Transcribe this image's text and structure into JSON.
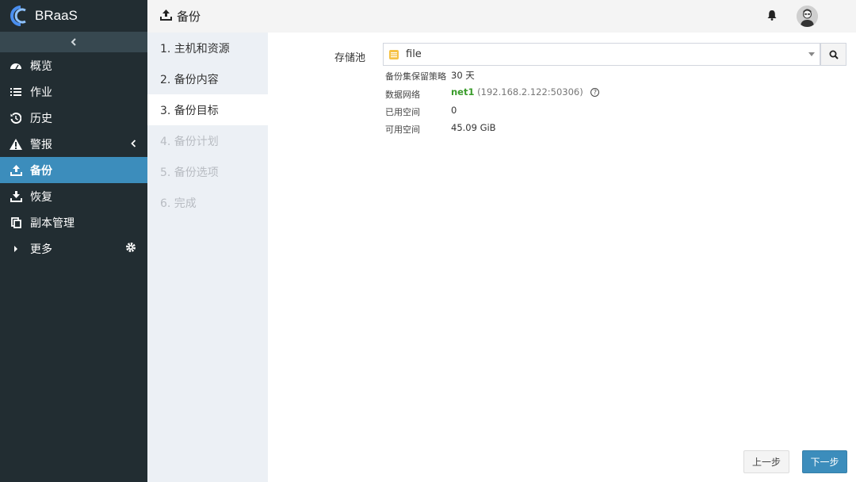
{
  "app": {
    "name": "BRaaS"
  },
  "header": {
    "title": "备份"
  },
  "sidebar": {
    "items": [
      {
        "label": "概览",
        "icon": "dashboard-icon"
      },
      {
        "label": "作业",
        "icon": "tasks-icon"
      },
      {
        "label": "历史",
        "icon": "history-icon"
      },
      {
        "label": "警报",
        "icon": "warning-icon"
      },
      {
        "label": "备份",
        "icon": "upload-icon"
      },
      {
        "label": "恢复",
        "icon": "download-icon"
      },
      {
        "label": "副本管理",
        "icon": "copy-icon"
      },
      {
        "label": "更多",
        "icon": "caret-right-icon"
      }
    ]
  },
  "steps": [
    {
      "label": "1. 主机和资源",
      "state": "done"
    },
    {
      "label": "2. 备份内容",
      "state": "done"
    },
    {
      "label": "3. 备份目标",
      "state": "active"
    },
    {
      "label": "4. 备份计划",
      "state": "disabled"
    },
    {
      "label": "5. 备份选项",
      "state": "disabled"
    },
    {
      "label": "6. 完成",
      "state": "disabled"
    }
  ],
  "form": {
    "pool_label": "存储池",
    "pool_value": "file",
    "retention_label": "备份集保留策略",
    "retention_value": "30 天",
    "network_label": "数据网络",
    "network_name": "net1",
    "network_addr": "(192.168.2.122:50306)",
    "used_label": "已用空间",
    "used_value": "0",
    "free_label": "可用空间",
    "free_value": "45.09 GiB"
  },
  "buttons": {
    "prev": "上一步",
    "next": "下一步"
  },
  "colors": {
    "sidebar": "#222d32",
    "accent": "#3c8dbc",
    "network": "#3a9c2b"
  }
}
